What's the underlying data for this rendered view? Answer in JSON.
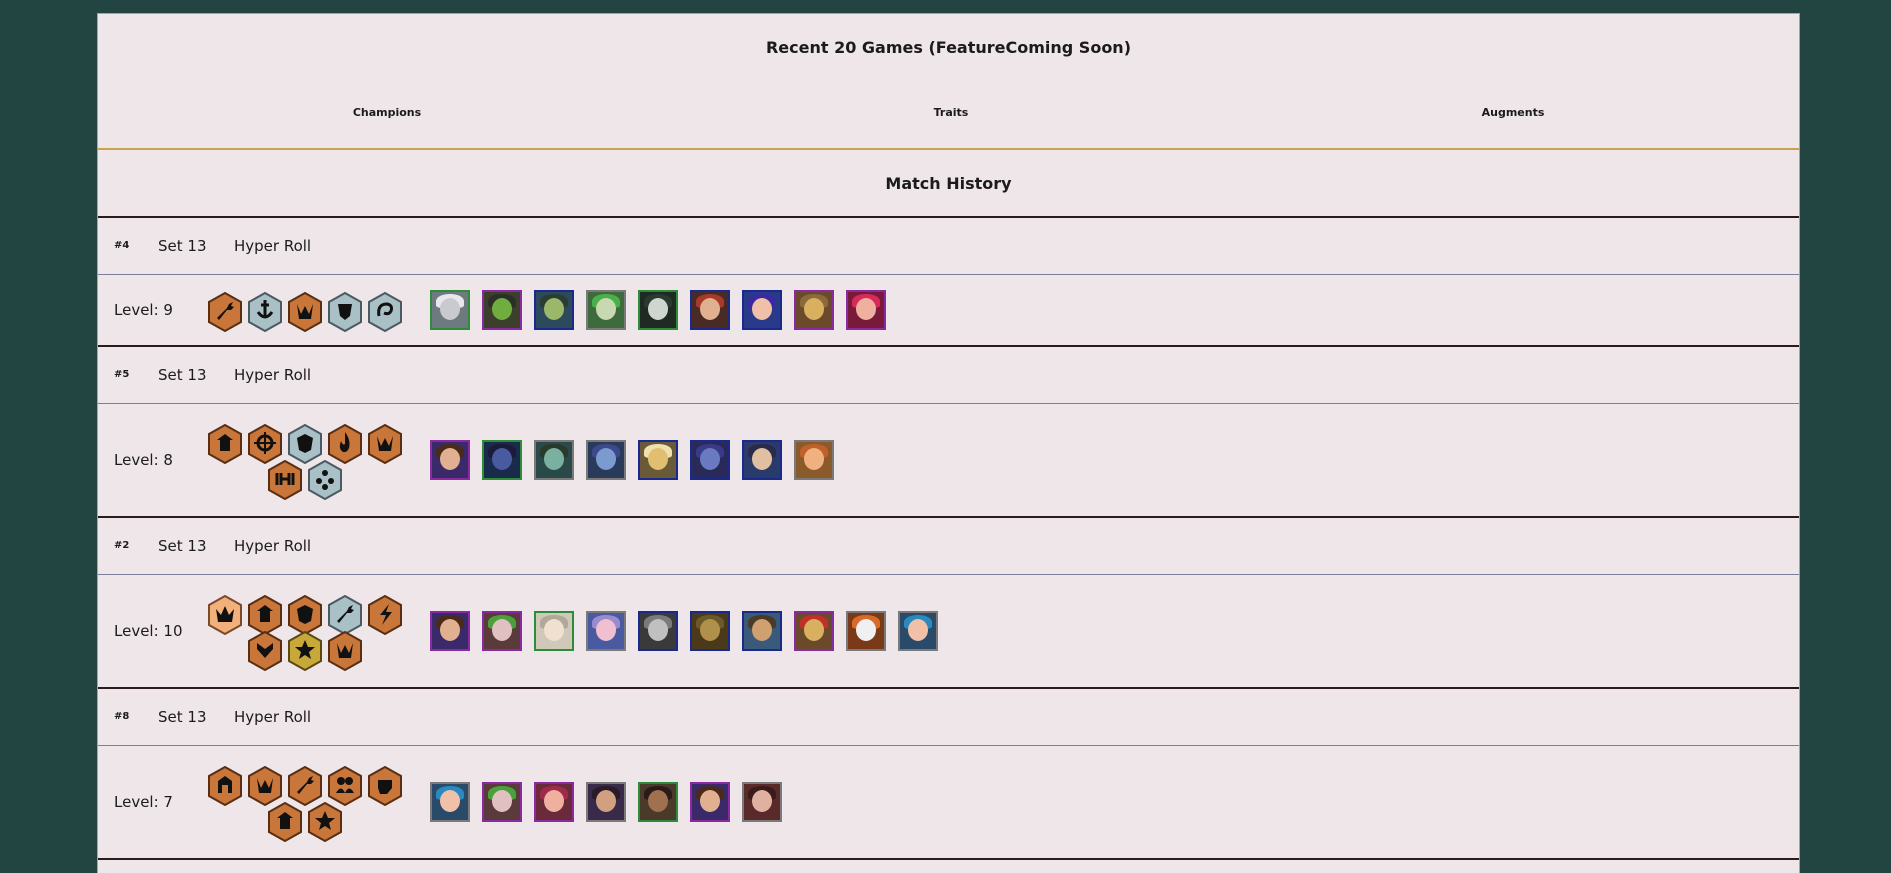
{
  "summary": {
    "title": "Recent 20 Games (FeatureComing Soon)",
    "tabs": [
      {
        "label": "Champions"
      },
      {
        "label": "Traits"
      },
      {
        "label": "Augments"
      }
    ]
  },
  "match_history": {
    "title": "Match History",
    "games": [
      {
        "placement": "#4",
        "set": "Set 13",
        "mode": "Hyper Roll",
        "level": "Level: 9",
        "traits": [
          {
            "icon": "wrench-trait-icon",
            "tier": "bronze"
          },
          {
            "icon": "anchor-trait-icon",
            "tier": "silver"
          },
          {
            "icon": "crest-trait-icon",
            "tier": "bronze"
          },
          {
            "icon": "shield-trait-icon",
            "tier": "silver"
          },
          {
            "icon": "swirl-trait-icon",
            "tier": "silver"
          }
        ],
        "champions": [
          {
            "border": "#2e8b3a",
            "bg": "#6d7a80",
            "skin": "#c9c9d0",
            "hair": "#e8e8ec"
          },
          {
            "border": "#8a2aa0",
            "bg": "#3b3f2c",
            "skin": "#6fae3e",
            "hair": "#2c2e28"
          },
          {
            "border": "#1a2a8c",
            "bg": "#2d4a5c",
            "skin": "#9bb86a",
            "hair": "#2a3d32"
          },
          {
            "border": "#7a7a7a",
            "bg": "#3e6a3e",
            "skin": "#c8d8b0",
            "hair": "#49b04a"
          },
          {
            "border": "#2e8b3a",
            "bg": "#1e2a22",
            "skin": "#cfd6d0",
            "hair": "#2a3a2e"
          },
          {
            "border": "#1a2a8c",
            "bg": "#4a2a24",
            "skin": "#e0b090",
            "hair": "#a83a2a"
          },
          {
            "border": "#1a2a8c",
            "bg": "#2a3a8a",
            "skin": "#f0c0a8",
            "hair": "#3a2aa0"
          },
          {
            "border": "#8a2aa0",
            "bg": "#6a4a2a",
            "skin": "#d8b060",
            "hair": "#8a6a3a"
          },
          {
            "border": "#8a2aa0",
            "bg": "#7a1a3a",
            "skin": "#f0b0a0",
            "hair": "#d82a5a"
          }
        ]
      },
      {
        "placement": "#5",
        "set": "Set 13",
        "mode": "Hyper Roll",
        "level": "Level: 8",
        "traits": [
          {
            "icon": "bastion-trait-icon",
            "tier": "bronze"
          },
          {
            "icon": "crosshair-trait-icon",
            "tier": "bronze"
          },
          {
            "icon": "mask-trait-icon",
            "tier": "silver"
          },
          {
            "icon": "flame-trait-icon",
            "tier": "bronze"
          },
          {
            "icon": "crest-trait-icon",
            "tier": "bronze"
          },
          {
            "icon": "dumbbell-trait-icon",
            "tier": "bronze"
          },
          {
            "icon": "orb-trait-icon",
            "tier": "silver"
          }
        ],
        "champions": [
          {
            "border": "#8a2aa0",
            "bg": "#3a2a6a",
            "skin": "#e0b090",
            "hair": "#4a2a1a"
          },
          {
            "border": "#2e8b3a",
            "bg": "#1a2a4a",
            "skin": "#4a5aa0",
            "hair": "#1a1a3a"
          },
          {
            "border": "#7a7a7a",
            "bg": "#2a4a4a",
            "skin": "#7ab0a0",
            "hair": "#2a3a2a"
          },
          {
            "border": "#7a7a7a",
            "bg": "#2a3a5a",
            "skin": "#7a9ad0",
            "hair": "#3a4a8a"
          },
          {
            "border": "#1a2a8c",
            "bg": "#6a5a3a",
            "skin": "#e0c070",
            "hair": "#f0e0b0"
          },
          {
            "border": "#1a2a8c",
            "bg": "#2a2a5a",
            "skin": "#6a7ac0",
            "hair": "#3a3a8a"
          },
          {
            "border": "#1a2a8c",
            "bg": "#2a3a6a",
            "skin": "#e0c0a0",
            "hair": "#2a2a4a"
          },
          {
            "border": "#7a7a7a",
            "bg": "#8a5a2a",
            "skin": "#f0b080",
            "hair": "#c0602a"
          }
        ]
      },
      {
        "placement": "#2",
        "set": "Set 13",
        "mode": "Hyper Roll",
        "level": "Level: 10",
        "traits": [
          {
            "icon": "crown-trait-icon",
            "tier": "light"
          },
          {
            "icon": "bastion-trait-icon",
            "tier": "bronze"
          },
          {
            "icon": "mask-trait-icon",
            "tier": "bronze"
          },
          {
            "icon": "wrench-trait-icon",
            "tier": "silver"
          },
          {
            "icon": "bolt-trait-icon",
            "tier": "bronze"
          },
          {
            "icon": "chevron-trait-icon",
            "tier": "bronze"
          },
          {
            "icon": "star-trait-icon",
            "tier": "gold"
          },
          {
            "icon": "crest-trait-icon",
            "tier": "bronze"
          }
        ],
        "champions": [
          {
            "border": "#8a2aa0",
            "bg": "#3a2a6a",
            "skin": "#e0b090",
            "hair": "#4a2a1a"
          },
          {
            "border": "#8a2aa0",
            "bg": "#5a3a3a",
            "skin": "#e0c0c0",
            "hair": "#4aa03a"
          },
          {
            "border": "#2e8b3a",
            "bg": "#d0c8b8",
            "skin": "#f0e0d0",
            "hair": "#b0a898"
          },
          {
            "border": "#7a7a7a",
            "bg": "#4a5aa0",
            "skin": "#f0c0d0",
            "hair": "#9a8ad0"
          },
          {
            "border": "#1a2a8c",
            "bg": "#3a3a3a",
            "skin": "#c0c0c0",
            "hair": "#7a7a7a"
          },
          {
            "border": "#1a2a8c",
            "bg": "#4a3a1a",
            "skin": "#b0904a",
            "hair": "#6a5a2a"
          },
          {
            "border": "#1a2a8c",
            "bg": "#3a5a7a",
            "skin": "#d0a070",
            "hair": "#4a3a2a"
          },
          {
            "border": "#8a2aa0",
            "bg": "#6a4a2a",
            "skin": "#d8b060",
            "hair": "#c0302a"
          },
          {
            "border": "#7a7a7a",
            "bg": "#7a3a1a",
            "skin": "#f0f0f0",
            "hair": "#d86a2a"
          },
          {
            "border": "#7a7a7a",
            "bg": "#2a4a6a",
            "skin": "#f0c0a8",
            "hair": "#2a8ac0"
          }
        ]
      },
      {
        "placement": "#8",
        "set": "Set 13",
        "mode": "Hyper Roll",
        "level": "Level: 7",
        "traits": [
          {
            "icon": "gate-trait-icon",
            "tier": "bronze"
          },
          {
            "icon": "crest-trait-icon",
            "tier": "bronze"
          },
          {
            "icon": "wrench-trait-icon",
            "tier": "bronze"
          },
          {
            "icon": "duo-trait-icon",
            "tier": "bronze"
          },
          {
            "icon": "fist-trait-icon",
            "tier": "bronze"
          },
          {
            "icon": "bastion-trait-icon",
            "tier": "bronze"
          },
          {
            "icon": "star-trait-icon",
            "tier": "bronze"
          }
        ],
        "champions": [
          {
            "border": "#7a7a7a",
            "bg": "#2a4a6a",
            "skin": "#f0c0a8",
            "hair": "#2a8ac0"
          },
          {
            "border": "#8a2aa0",
            "bg": "#5a3a3a",
            "skin": "#e0c0c0",
            "hair": "#4aa03a"
          },
          {
            "border": "#8a2aa0",
            "bg": "#6a2a3a",
            "skin": "#f0b0a0",
            "hair": "#a02a4a"
          },
          {
            "border": "#7a7a7a",
            "bg": "#3a2a4a",
            "skin": "#d0a080",
            "hair": "#2a1a2a"
          },
          {
            "border": "#2e8b3a",
            "bg": "#4a3a2a",
            "skin": "#a07050",
            "hair": "#2a1a1a"
          },
          {
            "border": "#8a2aa0",
            "bg": "#3a2a6a",
            "skin": "#e0b090",
            "hair": "#4a2a1a"
          },
          {
            "border": "#7a7a7a",
            "bg": "#5a2a2a",
            "skin": "#e0b0a0",
            "hair": "#3a1a1a"
          }
        ]
      }
    ]
  }
}
